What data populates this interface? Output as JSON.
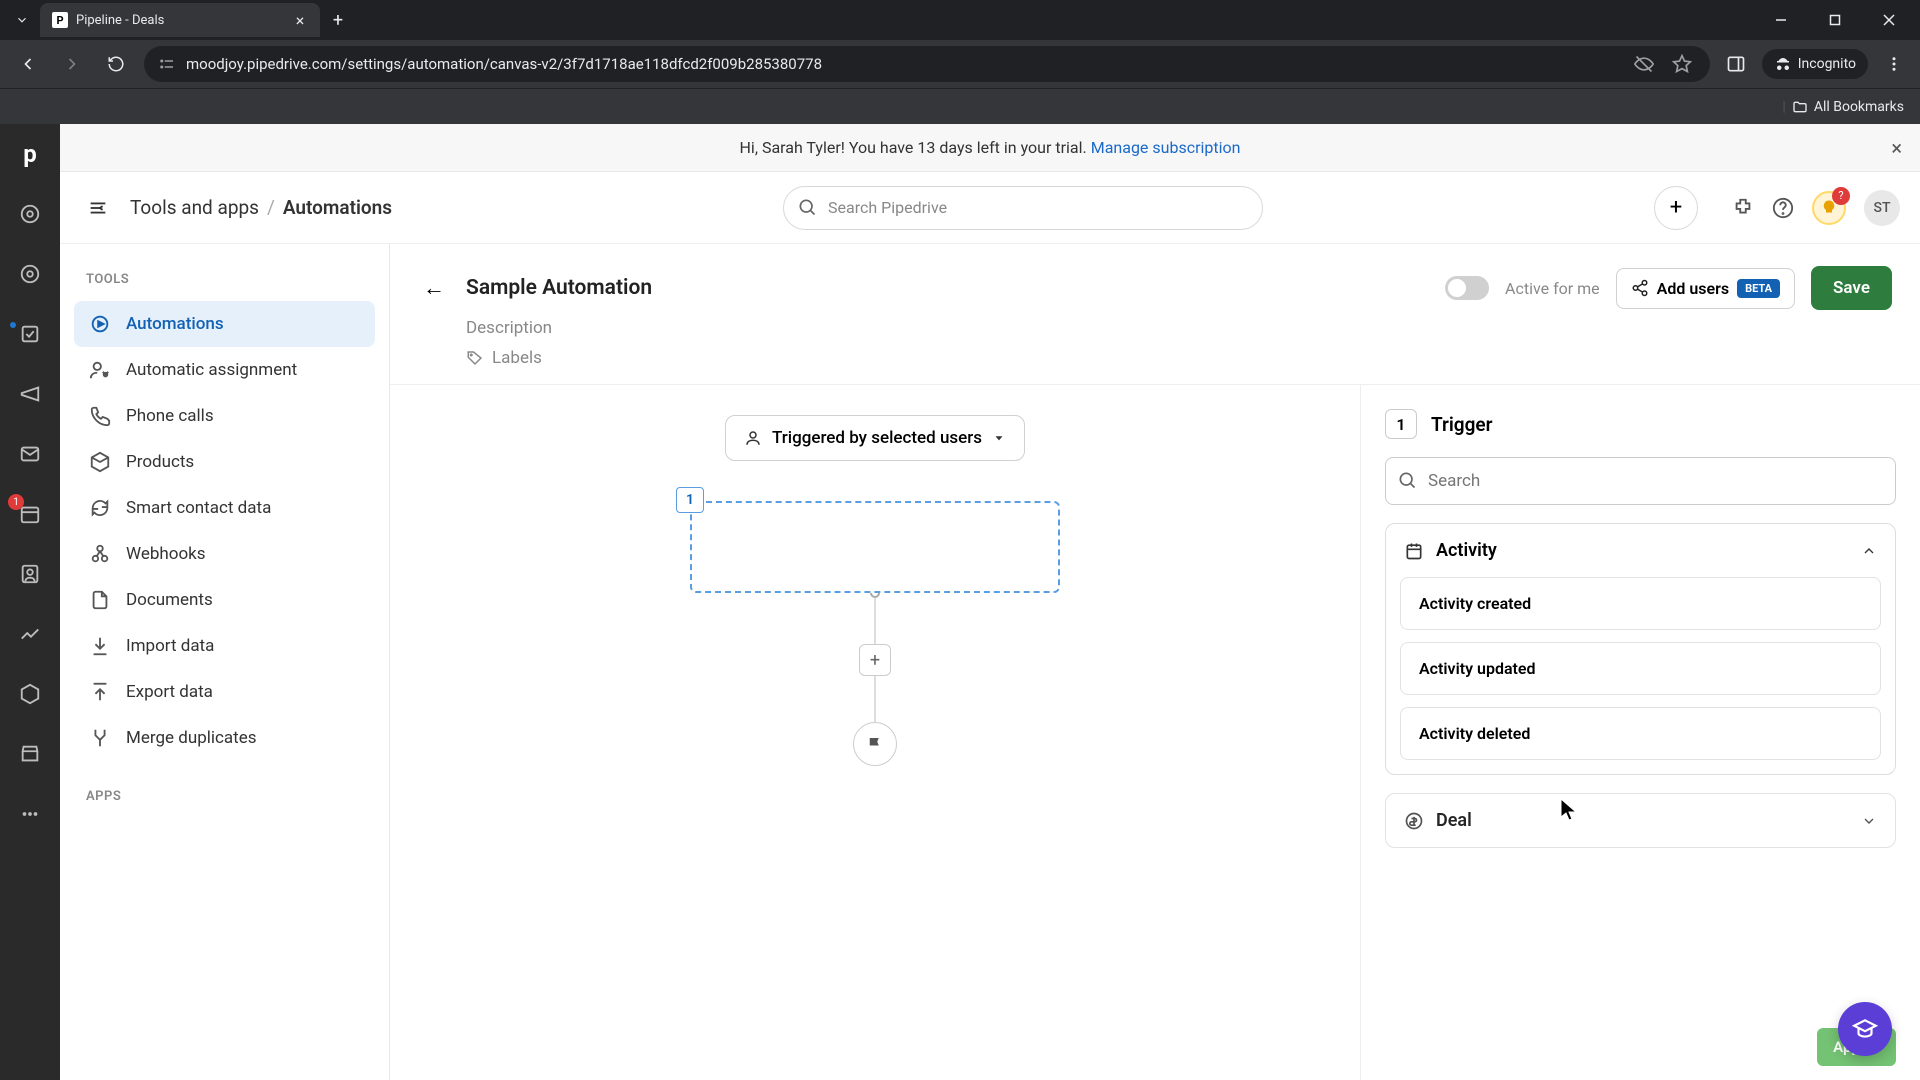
{
  "browser": {
    "tab_title": "Pipeline - Deals",
    "tab_favicon_letter": "P",
    "url": "moodjoy.pipedrive.com/settings/automation/canvas-v2/3f7d1718ae118dfcd2f009b285380778",
    "incognito_label": "Incognito",
    "all_bookmarks": "All Bookmarks"
  },
  "rail": {
    "mail_badge": "1"
  },
  "trial": {
    "text_prefix": "Hi, Sarah Tyler! You have 13 days left in your trial.",
    "link": "Manage subscription"
  },
  "breadcrumb": {
    "parent": "Tools and apps",
    "current": "Automations"
  },
  "search_placeholder": "Search Pipedrive",
  "topbar": {
    "bulb_badge": "?",
    "avatar_initials": "ST"
  },
  "sidebar": {
    "tools_label": "TOOLS",
    "apps_label": "APPS",
    "items": [
      {
        "label": "Automations"
      },
      {
        "label": "Automatic assignment"
      },
      {
        "label": "Phone calls"
      },
      {
        "label": "Products"
      },
      {
        "label": "Smart contact data"
      },
      {
        "label": "Webhooks"
      },
      {
        "label": "Documents"
      },
      {
        "label": "Import data"
      },
      {
        "label": "Export data"
      },
      {
        "label": "Merge duplicates"
      }
    ]
  },
  "automation": {
    "title": "Sample Automation",
    "toggle_label": "Active for me",
    "add_users": "Add users",
    "beta": "BETA",
    "save": "Save",
    "description": "Description",
    "labels": "Labels"
  },
  "canvas": {
    "trigger_button": "Triggered by selected users",
    "step_number": "1"
  },
  "panel": {
    "step_number": "1",
    "title": "Trigger",
    "search_placeholder": "Search",
    "groups": [
      {
        "title": "Activity",
        "items": [
          "Activity created",
          "Activity updated",
          "Activity deleted"
        ]
      },
      {
        "title": "Deal"
      }
    ],
    "apply": "Apply t"
  }
}
